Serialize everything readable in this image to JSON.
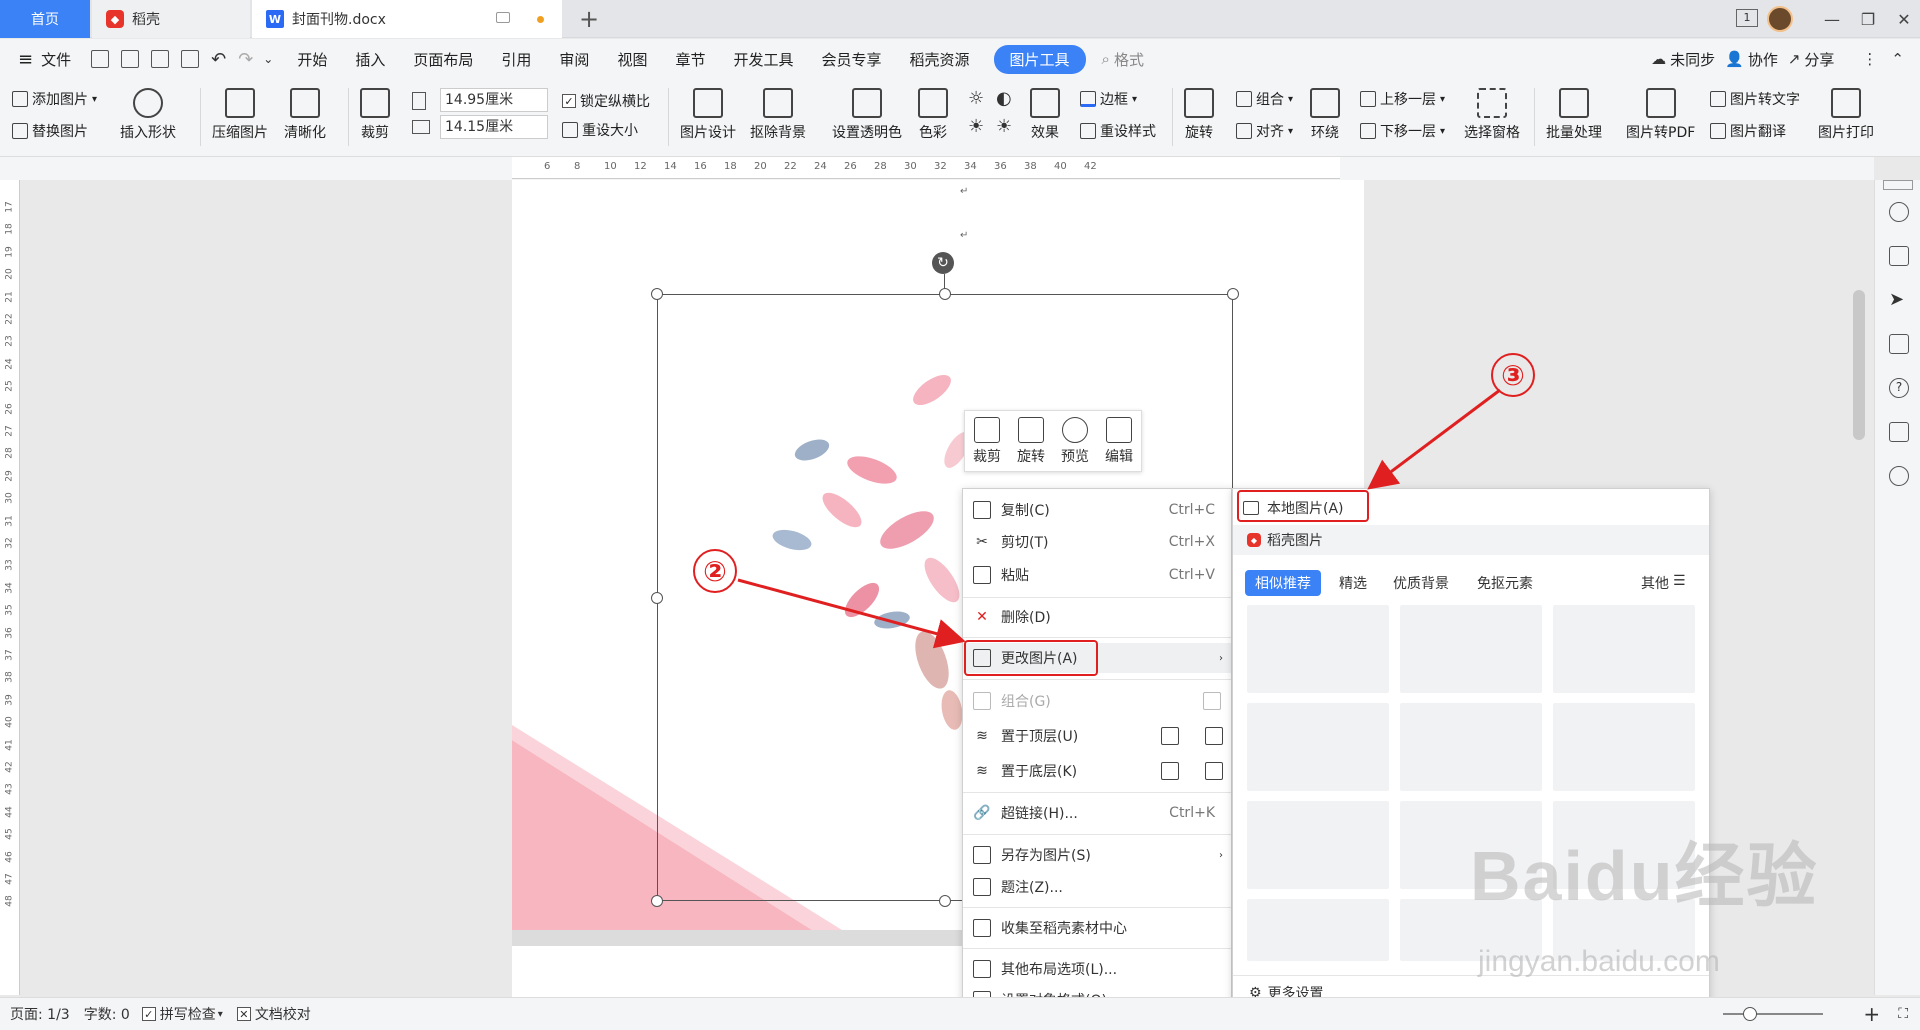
{
  "tabs": {
    "home": "首页",
    "daoke": "稻壳",
    "doc": "封面刊物.docx",
    "add": "+"
  },
  "window": {
    "page_badge": "1"
  },
  "menubar": {
    "file": "文件",
    "items": [
      "开始",
      "插入",
      "页面布局",
      "引用",
      "审阅",
      "视图",
      "章节",
      "开发工具",
      "会员专享",
      "稻壳资源"
    ],
    "active": "图片工具",
    "search": "格式",
    "sync": "未同步",
    "collab": "协作",
    "share": "分享"
  },
  "ribbon": {
    "add_image": "添加图片",
    "replace_image": "替换图片",
    "insert_shape": "插入形状",
    "compress": "压缩图片",
    "sharpen": "清晰化",
    "crop": "裁剪",
    "width": "14.95厘米",
    "height": "14.15厘米",
    "lock_ratio": "锁定纵横比",
    "reset_size": "重设大小",
    "design": "图片设计",
    "remove_bg": "抠除背景",
    "transparent": "设置透明色",
    "color": "色彩",
    "effect": "效果",
    "border": "边框",
    "reset_style": "重设样式",
    "rotate": "旋转",
    "group": "组合",
    "align": "对齐",
    "wrap": "环绕",
    "bring_forward": "上移一层",
    "send_backward": "下移一层",
    "selection_pane": "选择窗格",
    "batch": "批量处理",
    "to_pdf": "图片转PDF",
    "to_text": "图片转文字",
    "translate": "图片翻译",
    "print": "图片打印"
  },
  "ruler": {
    "h_ticks": [
      "6",
      "8",
      "10",
      "12",
      "14",
      "16",
      "18",
      "20",
      "22",
      "24",
      "26",
      "28",
      "30",
      "32",
      "34",
      "36",
      "38",
      "40",
      "42"
    ],
    "v_ticks": [
      "17",
      "18",
      "19",
      "20",
      "21",
      "22",
      "23",
      "24",
      "25",
      "26",
      "27",
      "28",
      "29",
      "30",
      "31",
      "32",
      "33",
      "34",
      "35",
      "36",
      "37",
      "38",
      "39",
      "40",
      "41",
      "42",
      "43",
      "44",
      "45",
      "46",
      "47",
      "48"
    ]
  },
  "mini_toolbar": {
    "crop": "裁剪",
    "rotate": "旋转",
    "preview": "预览",
    "edit": "编辑"
  },
  "context_menu": {
    "copy": {
      "label": "复制(C)",
      "shortcut": "Ctrl+C"
    },
    "cut": {
      "label": "剪切(T)",
      "shortcut": "Ctrl+X"
    },
    "paste": {
      "label": "粘贴",
      "shortcut": "Ctrl+V"
    },
    "delete": {
      "label": "删除(D)"
    },
    "change_image": {
      "label": "更改图片(A)"
    },
    "group": {
      "label": "组合(G)"
    },
    "bring_to_front": {
      "label": "置于顶层(U)"
    },
    "send_to_back": {
      "label": "置于底层(K)"
    },
    "hyperlink": {
      "label": "超链接(H)...",
      "shortcut": "Ctrl+K"
    },
    "save_as_image": {
      "label": "另存为图片(S)"
    },
    "caption": {
      "label": "题注(Z)..."
    },
    "collect": {
      "label": "收集至稻壳素材中心"
    },
    "layout": {
      "label": "其他布局选项(L)..."
    },
    "format": {
      "label": "设置对象格式(O)..."
    }
  },
  "submenu": {
    "local": "本地图片(A)",
    "daoke": "稻壳图片",
    "tabs": [
      "相似推荐",
      "精选",
      "优质背景",
      "免抠元素"
    ],
    "other": "其他",
    "more_settings": "更多设置"
  },
  "annotations": {
    "two": "②",
    "three": "③"
  },
  "status": {
    "page": "页面: 1/3",
    "words": "字数: 0",
    "spell": "拼写检查",
    "proof": "文档校对"
  },
  "watermark": {
    "brand": "Baidu经验",
    "url": "jingyan.baidu.com"
  },
  "colors": {
    "accent": "#3b82f6",
    "annotation": "#e02020",
    "pink": "#f7b6c0"
  }
}
